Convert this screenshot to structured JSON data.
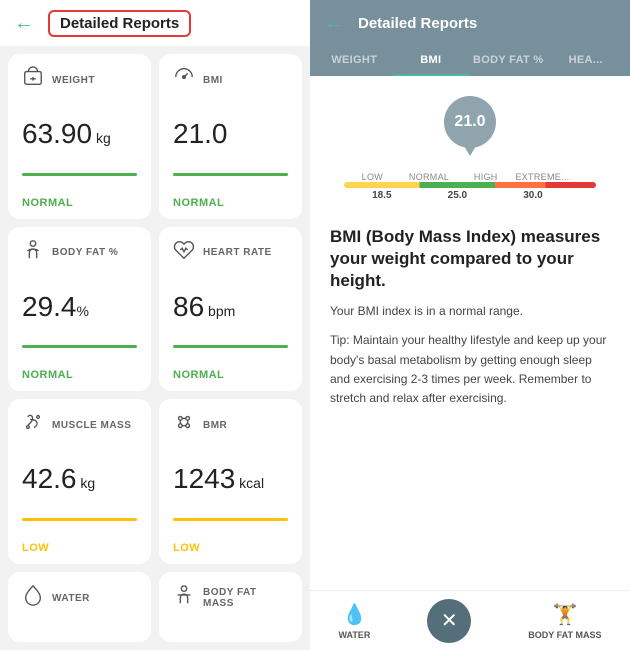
{
  "left": {
    "back_arrow": "←",
    "title": "Detailed Reports",
    "metrics": [
      {
        "icon": "⊟",
        "label": "WEIGHT",
        "value": "63.90",
        "unit": " kg",
        "status": "NORMAL",
        "status_class": "status-green",
        "bar_class": "bar-green"
      },
      {
        "icon": "🕐",
        "label": "BMI",
        "value": "21.0",
        "unit": "",
        "status": "NORMAL",
        "status_class": "status-green",
        "bar_class": "bar-green"
      },
      {
        "icon": "👤",
        "label": "BODY FAT %",
        "value": "29.4",
        "unit": "%",
        "status": "NORMAL",
        "status_class": "status-green",
        "bar_class": "bar-green"
      },
      {
        "icon": "♥",
        "label": "HEART RATE",
        "value": "86",
        "unit": " bpm",
        "status": "NORMAL",
        "status_class": "status-green",
        "bar_class": "bar-green"
      },
      {
        "icon": "💪",
        "label": "MUSCLE MASS",
        "value": "42.6",
        "unit": " kg",
        "status": "LOW",
        "status_class": "status-yellow",
        "bar_class": "bar-yellow"
      },
      {
        "icon": "⚙",
        "label": "BMR",
        "value": "1243",
        "unit": " kcal",
        "status": "LOW",
        "status_class": "status-yellow",
        "bar_class": "bar-yellow"
      }
    ],
    "partial_metrics": [
      {
        "icon": "💧",
        "label": "WATER"
      },
      {
        "icon": "🏋",
        "label": "BODY FAT MASS"
      }
    ]
  },
  "right": {
    "back_arrow": "←",
    "title": "Detailed Reports",
    "tabs": [
      {
        "label": "WEIGHT",
        "active": false
      },
      {
        "label": "BMI",
        "active": true
      },
      {
        "label": "BODY FAT %",
        "active": false
      },
      {
        "label": "HEA...",
        "active": false
      }
    ],
    "bmi_gauge": {
      "value": "21.0",
      "labels": [
        "LOW",
        "NORMAL",
        "HIGH",
        "EXTREME..."
      ],
      "values": [
        "18.5",
        "25.0",
        "30.0"
      ]
    },
    "bmi_title": "BMI (Body Mass Index) measures your weight compared to your height.",
    "bmi_normal": "Your BMI index is in a normal range.",
    "bmi_tip": "Tip: Maintain your healthy lifestyle and keep up your body's basal metabolism by getting enough sleep and exercising 2-3 times per week. Remember to stretch and relax after exercising.",
    "bottom_tabs": [
      {
        "icon": "💧",
        "label": "WATER"
      },
      {
        "icon": "×",
        "label": ""
      },
      {
        "icon": "🏋",
        "label": "BODY FAT MASS"
      }
    ]
  }
}
